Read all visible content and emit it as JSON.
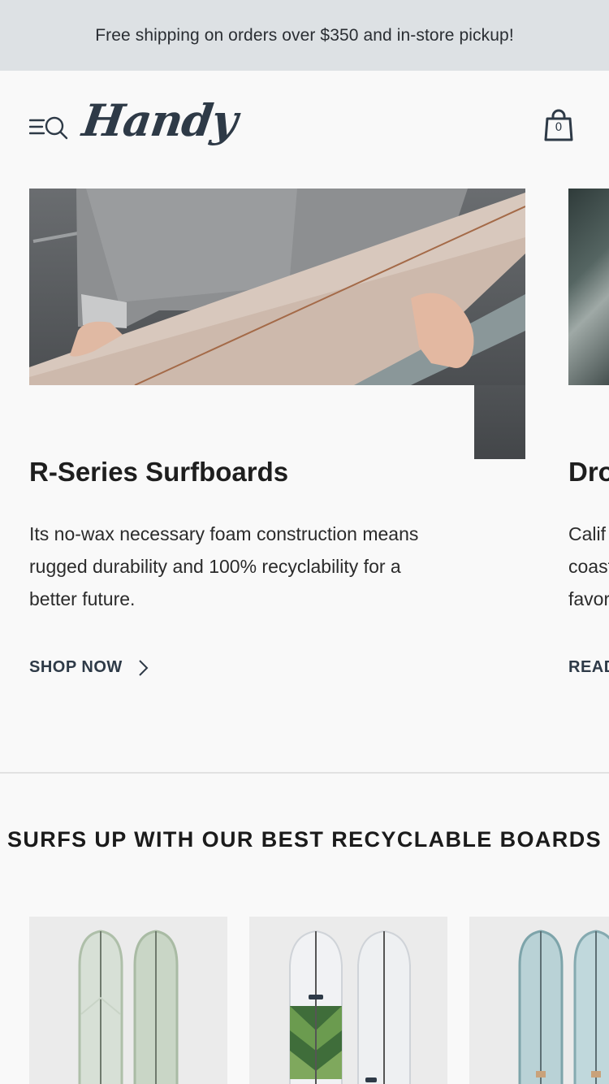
{
  "announcement": "Free shipping on orders over $350 and in-store pickup!",
  "header": {
    "logo": "Handy",
    "cart_count": "0"
  },
  "slides": [
    {
      "title": "R-Series Surfboards",
      "description": "Its no-wax necessary foam construction means rugged durability and 100% recyclability for a better future.",
      "link": "SHOP NOW"
    },
    {
      "title": "Dro",
      "description_lines": [
        "Calif",
        "coast",
        "favor"
      ],
      "link": "READ"
    }
  ],
  "section": {
    "title": "SURFS UP WITH OUR BEST RECYCLABLE BOARDS"
  },
  "colors": {
    "announcement_bg": "#dde1e4",
    "brand": "#2e3a47",
    "page_bg": "#f9f9f9",
    "card_bg": "#ebebeb"
  }
}
